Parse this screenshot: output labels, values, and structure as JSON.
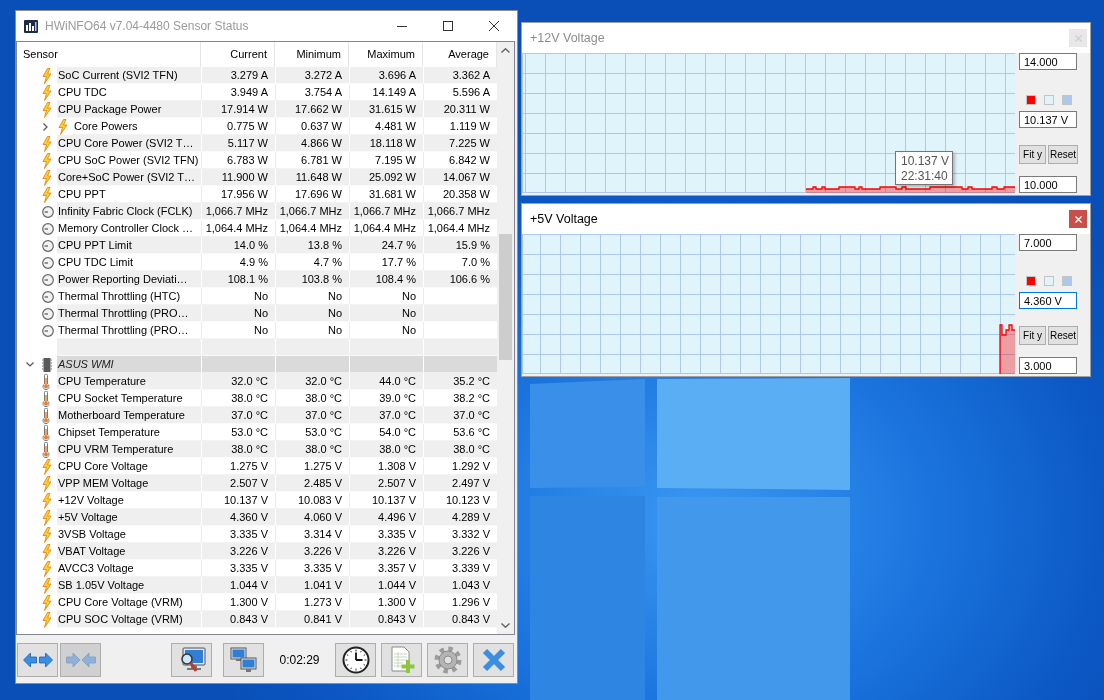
{
  "window": {
    "title": "HWiNFO64 v7.04-4480 Sensor Status",
    "active": false
  },
  "table": {
    "columns": [
      "Sensor",
      "Current",
      "Minimum",
      "Maximum",
      "Average"
    ],
    "groups": [
      {
        "rows": [
          {
            "kind": "power",
            "name": "SoC Current (SVI2 TFN)",
            "current": "3.279 A",
            "minimum": "3.272 A",
            "maximum": "3.696 A",
            "average": "3.362 A"
          },
          {
            "kind": "power",
            "name": "CPU TDC",
            "current": "3.949 A",
            "minimum": "3.754 A",
            "maximum": "14.149 A",
            "average": "5.596 A"
          },
          {
            "kind": "power",
            "name": "CPU Package Power",
            "current": "17.914 W",
            "minimum": "17.662 W",
            "maximum": "31.615 W",
            "average": "20.311 W"
          },
          {
            "kind": "power",
            "name": "Core Powers",
            "expanded": false,
            "current": "0.775 W",
            "minimum": "0.637 W",
            "maximum": "4.481 W",
            "average": "1.119 W"
          },
          {
            "kind": "power",
            "name": "CPU Core Power (SVI2 T…",
            "current": "5.117 W",
            "minimum": "4.866 W",
            "maximum": "18.118 W",
            "average": "7.225 W"
          },
          {
            "kind": "power",
            "name": "CPU SoC Power (SVI2 TFN)",
            "current": "6.783 W",
            "minimum": "6.781 W",
            "maximum": "7.195 W",
            "average": "6.842 W"
          },
          {
            "kind": "power",
            "name": "Core+SoC Power (SVI2 T…",
            "current": "11.900 W",
            "minimum": "11.648 W",
            "maximum": "25.092 W",
            "average": "14.067 W"
          },
          {
            "kind": "power",
            "name": "CPU PPT",
            "current": "17.956 W",
            "minimum": "17.696 W",
            "maximum": "31.681 W",
            "average": "20.358 W"
          },
          {
            "kind": "clock",
            "name": "Infinity Fabric Clock (FCLK)",
            "current": "1,066.7 MHz",
            "minimum": "1,066.7 MHz",
            "maximum": "1,066.7 MHz",
            "average": "1,066.7 MHz"
          },
          {
            "kind": "clock",
            "name": "Memory Controller Clock …",
            "current": "1,064.4 MHz",
            "minimum": "1,064.4 MHz",
            "maximum": "1,064.4 MHz",
            "average": "1,064.4 MHz"
          },
          {
            "kind": "clock",
            "name": "CPU PPT Limit",
            "current": "14.0 %",
            "minimum": "13.8 %",
            "maximum": "24.7 %",
            "average": "15.9 %"
          },
          {
            "kind": "clock",
            "name": "CPU TDC Limit",
            "current": "4.9 %",
            "minimum": "4.7 %",
            "maximum": "17.7 %",
            "average": "7.0 %"
          },
          {
            "kind": "clock",
            "name": "Power Reporting Deviati…",
            "current": "108.1 %",
            "minimum": "103.8 %",
            "maximum": "108.4 %",
            "average": "106.6 %"
          },
          {
            "kind": "clock",
            "name": "Thermal Throttling (HTC)",
            "current": "No",
            "minimum": "No",
            "maximum": "No"
          },
          {
            "kind": "clock",
            "name": "Thermal Throttling (PRO…",
            "current": "No",
            "minimum": "No",
            "maximum": "No"
          },
          {
            "kind": "clock",
            "name": "Thermal Throttling (PRO…",
            "current": "No",
            "minimum": "No",
            "maximum": "No"
          }
        ]
      },
      {
        "name": "ASUS WMI",
        "expanded": true,
        "rows": [
          {
            "kind": "temperature",
            "name": "CPU Temperature",
            "current": "32.0 °C",
            "minimum": "32.0 °C",
            "maximum": "44.0 °C",
            "average": "35.2 °C"
          },
          {
            "kind": "temperature",
            "name": "CPU Socket Temperature",
            "current": "38.0 °C",
            "minimum": "38.0 °C",
            "maximum": "39.0 °C",
            "average": "38.2 °C"
          },
          {
            "kind": "temperature",
            "name": "Motherboard Temperature",
            "current": "37.0 °C",
            "minimum": "37.0 °C",
            "maximum": "37.0 °C",
            "average": "37.0 °C"
          },
          {
            "kind": "temperature",
            "name": "Chipset Temperature",
            "current": "53.0 °C",
            "minimum": "53.0 °C",
            "maximum": "54.0 °C",
            "average": "53.6 °C"
          },
          {
            "kind": "temperature",
            "name": "CPU VRM Temperature",
            "current": "38.0 °C",
            "minimum": "38.0 °C",
            "maximum": "38.0 °C",
            "average": "38.0 °C"
          },
          {
            "kind": "power",
            "name": "CPU Core Voltage",
            "current": "1.275 V",
            "minimum": "1.275 V",
            "maximum": "1.308 V",
            "average": "1.292 V"
          },
          {
            "kind": "power",
            "name": "VPP MEM Voltage",
            "current": "2.507 V",
            "minimum": "2.485 V",
            "maximum": "2.507 V",
            "average": "2.497 V"
          },
          {
            "kind": "power",
            "name": "+12V Voltage",
            "current": "10.137 V",
            "minimum": "10.083 V",
            "maximum": "10.137 V",
            "average": "10.123 V"
          },
          {
            "kind": "power",
            "name": "+5V Voltage",
            "current": "4.360 V",
            "minimum": "4.060 V",
            "maximum": "4.496 V",
            "average": "4.289 V"
          },
          {
            "kind": "power",
            "name": "3VSB Voltage",
            "current": "3.335 V",
            "minimum": "3.314 V",
            "maximum": "3.335 V",
            "average": "3.332 V"
          },
          {
            "kind": "power",
            "name": "VBAT Voltage",
            "current": "3.226 V",
            "minimum": "3.226 V",
            "maximum": "3.226 V",
            "average": "3.226 V"
          },
          {
            "kind": "power",
            "name": "AVCC3 Voltage",
            "current": "3.335 V",
            "minimum": "3.335 V",
            "maximum": "3.357 V",
            "average": "3.339 V"
          },
          {
            "kind": "power",
            "name": "SB 1.05V Voltage",
            "current": "1.044 V",
            "minimum": "1.041 V",
            "maximum": "1.044 V",
            "average": "1.043 V"
          },
          {
            "kind": "power",
            "name": "CPU Core Voltage (VRM)",
            "current": "1.300 V",
            "minimum": "1.273 V",
            "maximum": "1.300 V",
            "average": "1.296 V"
          },
          {
            "kind": "power",
            "name": "CPU SOC Voltage (VRM)",
            "current": "0.843 V",
            "minimum": "0.841 V",
            "maximum": "0.843 V",
            "average": "0.843 V"
          }
        ]
      }
    ]
  },
  "toolbar": {
    "nav_buttons": [
      {
        "kind": "expand",
        "disabled": false
      },
      {
        "kind": "collapse",
        "disabled": true
      }
    ],
    "tool_buttons": [
      {
        "kind": "monitor-search",
        "disabled": false
      },
      {
        "kind": "network",
        "disabled": false
      }
    ],
    "timer": "0:02:29",
    "action_buttons": [
      {
        "kind": "clock",
        "disabled": false
      },
      {
        "kind": "report",
        "disabled": false
      },
      {
        "kind": "settings",
        "disabled": false
      },
      {
        "kind": "close",
        "disabled": false
      }
    ]
  },
  "graphs": [
    {
      "title": "+12V Voltage",
      "active": false,
      "upper": {
        "value": "14.000",
        "focused": false
      },
      "swatches": [
        {
          "color": "#ff0000"
        },
        {
          "color": "#e0f5fb"
        },
        {
          "color": "#adc8ea"
        }
      ],
      "current": {
        "value": "10.137 V",
        "focused": false
      },
      "buttons": [
        "Fit y",
        "Reset"
      ],
      "lower": {
        "value": "10.000",
        "focused": false
      },
      "tooltip": {
        "value": "10.137 V",
        "time": "22:31:40"
      }
    },
    {
      "title": "+5V Voltage",
      "active": true,
      "upper": {
        "value": "7.000",
        "focused": false
      },
      "swatches": [
        {
          "color": "#ff0000"
        },
        {
          "color": "#e0f5fb"
        },
        {
          "color": "#adc8ea"
        }
      ],
      "current": {
        "value": "4.360 V",
        "focused": true
      },
      "buttons": [
        "Fit y",
        "Reset"
      ],
      "lower": {
        "value": "3.000",
        "focused": false
      }
    }
  ]
}
